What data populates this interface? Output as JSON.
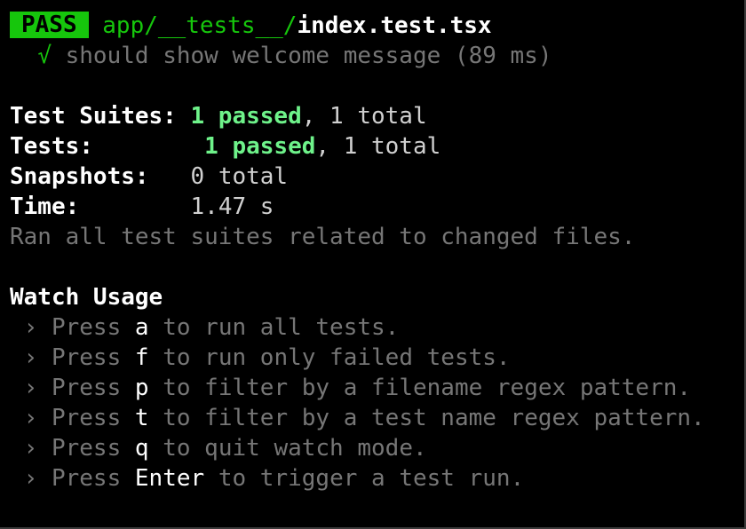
{
  "header": {
    "badge": "PASS",
    "path_dir": "app/__tests__/",
    "path_file": "index.test.tsx"
  },
  "test_result": {
    "check": "√",
    "text": "should show welcome message (89 ms)"
  },
  "summary": {
    "suites_label": "Test Suites:",
    "suites_passed": "1 passed",
    "suites_total": ", 1 total",
    "tests_label": "Tests:",
    "tests_passed": "1 passed",
    "tests_total": ", 1 total",
    "snapshots_label": "Snapshots:",
    "snapshots_value": "0 total",
    "time_label": "Time:",
    "time_value": "1.47 s",
    "ran_all": "Ran all test suites related to changed files."
  },
  "watch": {
    "title": "Watch Usage",
    "items": [
      {
        "arrow": "›",
        "press": "Press",
        "key": "a",
        "desc": "to run all tests."
      },
      {
        "arrow": "›",
        "press": "Press",
        "key": "f",
        "desc": "to run only failed tests."
      },
      {
        "arrow": "›",
        "press": "Press",
        "key": "p",
        "desc": "to filter by a filename regex pattern."
      },
      {
        "arrow": "›",
        "press": "Press",
        "key": "t",
        "desc": "to filter by a test name regex pattern."
      },
      {
        "arrow": "›",
        "press": "Press",
        "key": "q",
        "desc": "to quit watch mode."
      },
      {
        "arrow": "›",
        "press": "Press",
        "key": "Enter",
        "desc": "to trigger a test run."
      }
    ]
  },
  "colors": {
    "background": "#000000",
    "pass_badge": "#16c60c",
    "passed_text": "#6ef28a",
    "dim_text": "#767676"
  }
}
